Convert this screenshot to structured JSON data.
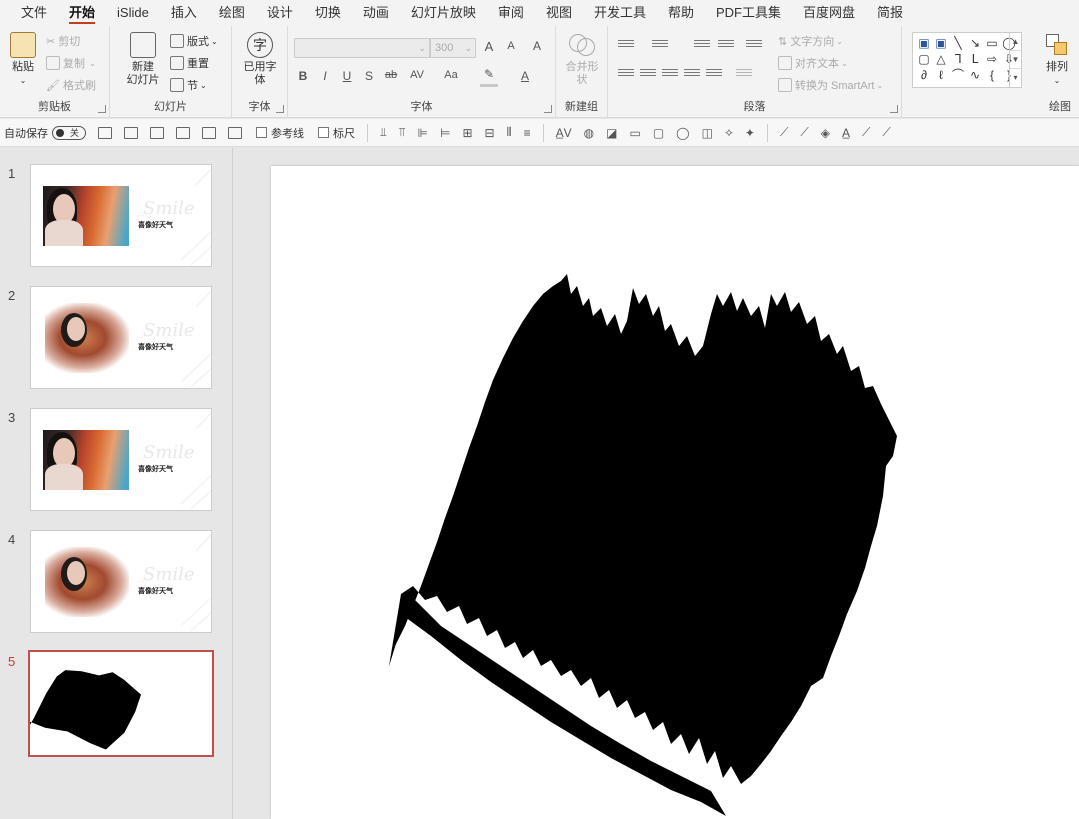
{
  "menu": {
    "tabs": [
      "文件",
      "开始",
      "iSlide",
      "插入",
      "绘图",
      "设计",
      "切换",
      "动画",
      "幻灯片放映",
      "审阅",
      "视图",
      "开发工具",
      "帮助",
      "PDF工具集",
      "百度网盘",
      "简报"
    ],
    "active_index": 1
  },
  "ribbon": {
    "clipboard": {
      "paste": "粘贴",
      "cut": "剪切",
      "copy": "复制",
      "format_painter": "格式刷",
      "label": "剪贴板"
    },
    "slides": {
      "new_slide_line1": "新建",
      "new_slide_line2": "幻灯片",
      "layout": "版式",
      "reset": "重置",
      "section": "节",
      "label": "幻灯片"
    },
    "font_group": {
      "used_fonts_line1": "已用字",
      "used_fonts_line2": "体",
      "label": "字体",
      "icon_glyph": "字"
    },
    "font": {
      "font_size": "300",
      "label": "字体",
      "bold": "B",
      "italic": "I",
      "underline": "U",
      "shadow": "S",
      "strike": "ab",
      "char_spacing": "AV",
      "change_case": "Aa",
      "grow": "A",
      "shrink": "A",
      "clear": "A"
    },
    "newgroup": {
      "merge_line1": "合并形",
      "merge_line2": "状",
      "label": "新建组"
    },
    "paragraph": {
      "text_direction": "文字方向",
      "align_text": "对齐文本",
      "smartart": "转换为 SmartArt",
      "label": "段落"
    },
    "drawing": {
      "arrange": "排列",
      "label": "绘图"
    }
  },
  "qat": {
    "autosave": "自动保存",
    "toggle_state": "关",
    "guides": "参考线",
    "ruler": "标尺"
  },
  "thumbnails": [
    {
      "number": "1",
      "script": "Smile",
      "small": "· · · ·",
      "title": "喜像好天气",
      "style": "photo",
      "active": false
    },
    {
      "number": "2",
      "script": "Smile",
      "small": "· · · ·",
      "title": "喜像好天气",
      "style": "brush",
      "active": false
    },
    {
      "number": "3",
      "script": "Smile",
      "small": "· · · ·",
      "title": "喜像好天气",
      "style": "photo",
      "active": false
    },
    {
      "number": "4",
      "script": "Smile",
      "small": "· · · ·",
      "title": "喜像好天气",
      "style": "brush",
      "active": false
    },
    {
      "number": "5",
      "script": "",
      "small": "",
      "title": "",
      "style": "blackbrush",
      "active": true
    }
  ],
  "colors": {
    "accent": "#c43e1c",
    "active_thumb_border": "#c0504d",
    "ribbon_bg": "#f3f3f3",
    "workspace_bg": "#e6e6e6",
    "brush_fill": "#000000"
  }
}
